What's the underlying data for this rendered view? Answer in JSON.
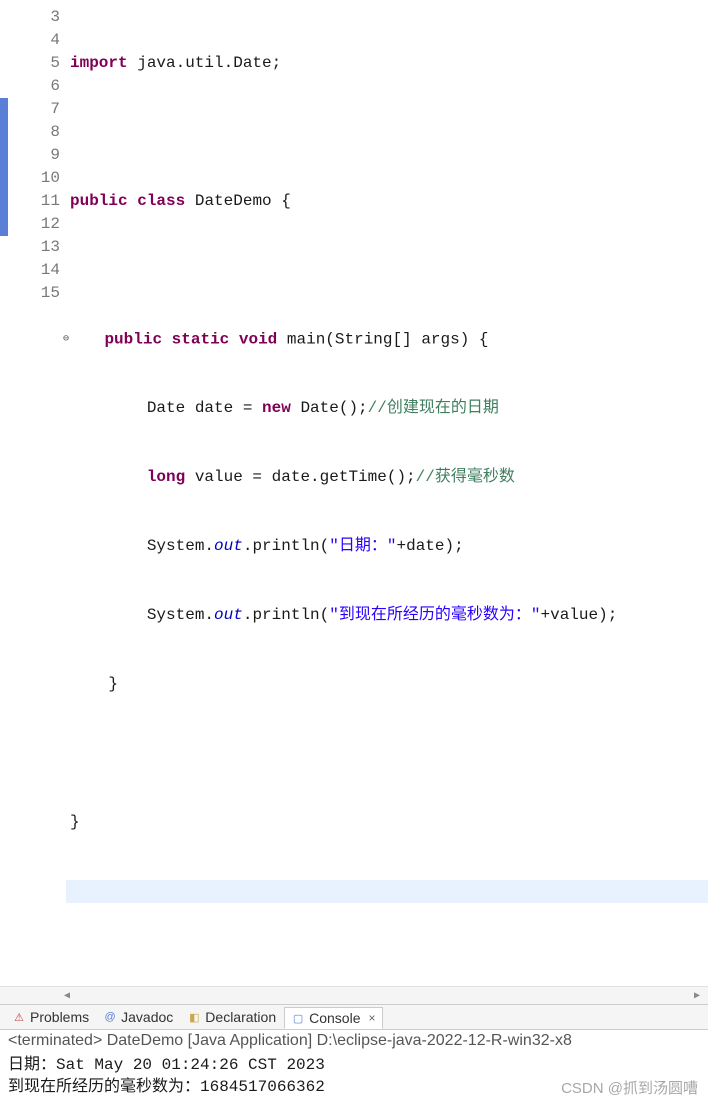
{
  "lines": {
    "n3": "3",
    "n4": "4",
    "n5": "5",
    "n6": "6",
    "n7": "7",
    "n8": "8",
    "n9": "9",
    "n10": "10",
    "n11": "11",
    "n12": "12",
    "n13": "13",
    "n14": "14",
    "n15": "15"
  },
  "code": {
    "l3": {
      "kw": "import",
      "rest": " java.util.Date;"
    },
    "l5": {
      "kw1": "public",
      "kw2": "class",
      "cls": " DateDemo ",
      "brace": "{"
    },
    "l7": {
      "kw1": "public",
      "kw2": "static",
      "kw3": "void",
      "m": " main",
      "args": "(String[] args) {"
    },
    "l8": {
      "pre": "        Date date = ",
      "kw": "new",
      "post": " Date();",
      "cmt": "//创建现在的日期"
    },
    "l9": {
      "pre": "        ",
      "kw": "long",
      "post": " value = date.getTime();",
      "cmt": "//获得毫秒数"
    },
    "l10": {
      "pre": "        System.",
      "out": "out",
      "mid": ".println(",
      "str": "\"日期：\"",
      "post": "+date);"
    },
    "l11": {
      "pre": "        System.",
      "out": "out",
      "mid": ".println(",
      "str": "\"到现在所经历的毫秒数为：\"",
      "post": "+value);"
    },
    "l12": "    }",
    "l14": "}"
  },
  "tabs": {
    "problems": "Problems",
    "javadoc": "Javadoc",
    "declaration": "Declaration",
    "console": "Console"
  },
  "console": {
    "header": "<terminated> DateDemo [Java Application] D:\\eclipse-java-2022-12-R-win32-x8",
    "line1": "日期：Sat May 20 01:24:26 CST 2023",
    "line2": "到现在所经历的毫秒数为：1684517066362"
  },
  "watermark": "CSDN @抓到汤圆嘈"
}
